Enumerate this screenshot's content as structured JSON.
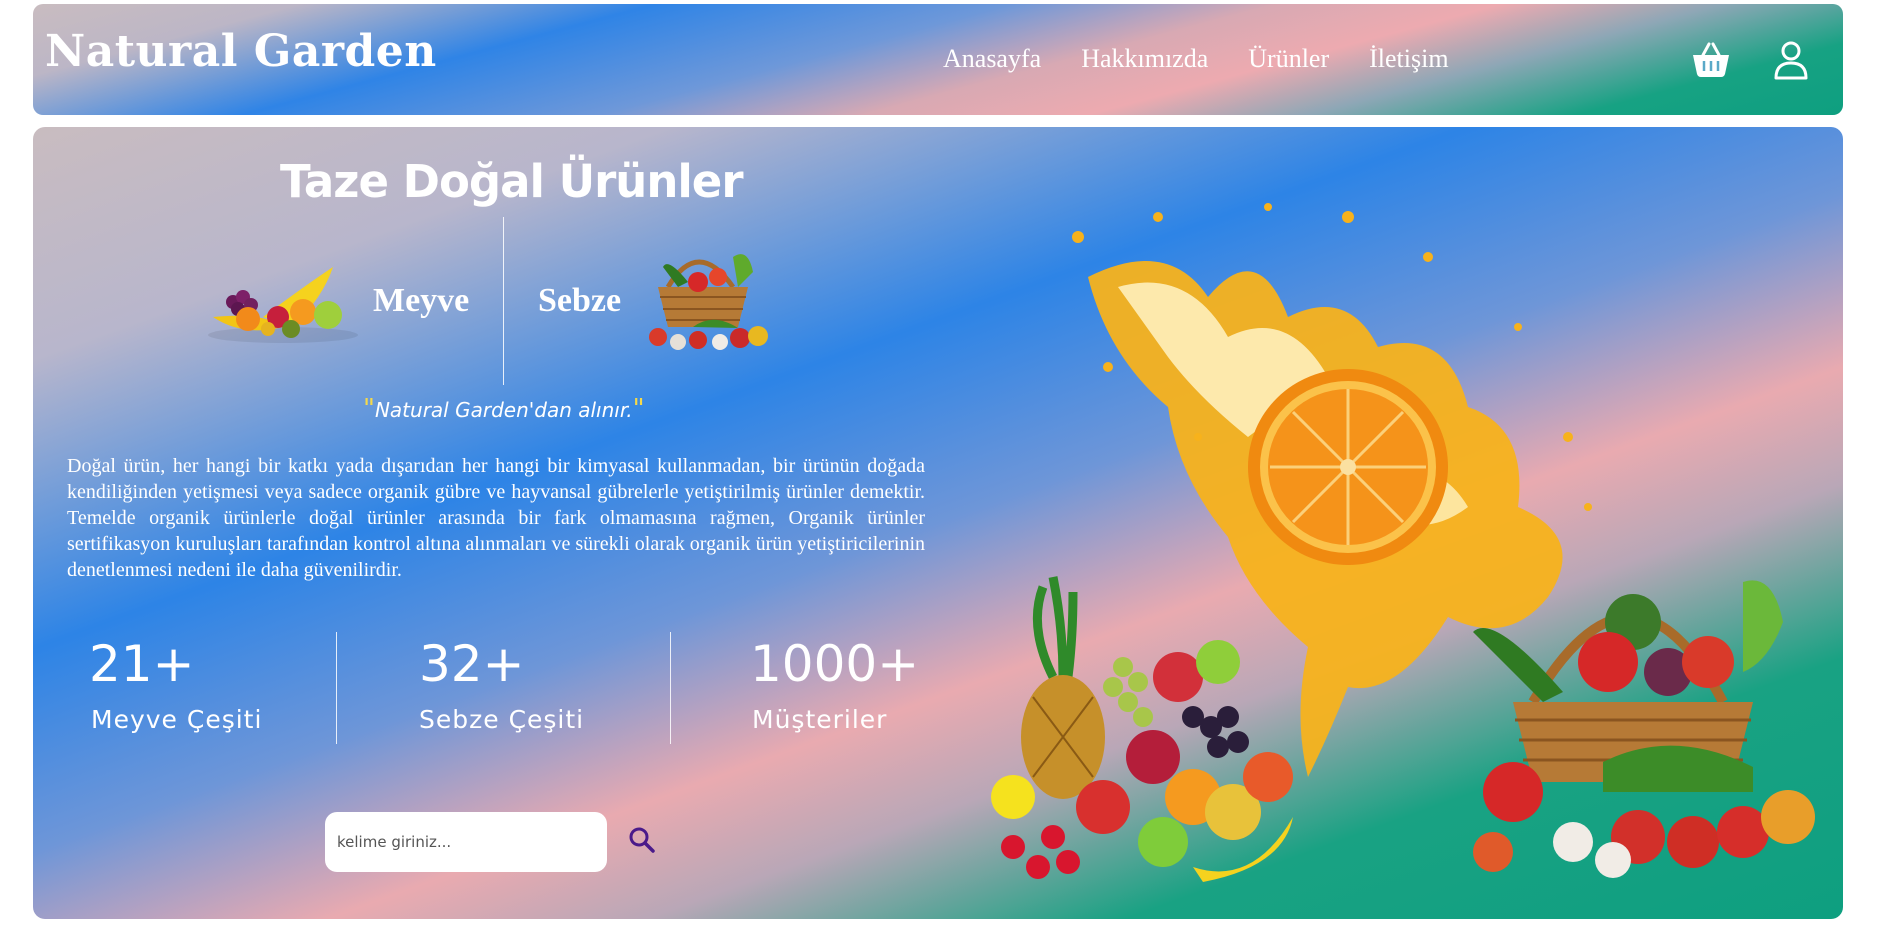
{
  "header": {
    "logo": "Natural Garden",
    "nav": [
      "Anasayfa",
      "Hakkımızda",
      "Ürünler",
      "İletişim"
    ],
    "icons": [
      "basket-icon",
      "user-icon"
    ]
  },
  "hero": {
    "title": "Taze Doğal Ürünler",
    "categories": {
      "fruit": "Meyve",
      "vegetable": "Sebze"
    },
    "tagline": "Natural Garden'dan alınır.",
    "description": "Doğal ürün, her hangi bir katkı yada dışarıdan her hangi bir kimyasal kullanmadan, bir ürünün doğada kendiliğinden yetişmesi veya sadece organik gübre ve hayvansal gübrelerle yetiştirilmiş ürünler demektir. Temelde organik ürünlerle doğal ürünler arasında bir fark olmamasına rağmen, Organik ürünler sertifikasyon kuruluşları tarafından kontrol altına alınmaları ve sürekli olarak organik ürün yetiştiricilerinin denetlenmesi nedeni ile daha güvenilirdir.",
    "stats": [
      {
        "value": "21+",
        "label": "Meyve Çeşiti"
      },
      {
        "value": "32+",
        "label": "Sebze Çeşiti"
      },
      {
        "value": "1000+",
        "label": "Müşteriler"
      }
    ],
    "search": {
      "placeholder": "kelime giriniz..."
    }
  },
  "colors": {
    "gradient": [
      "#c9bcc0",
      "#2d84e6",
      "#e9aab0",
      "#0e9f80"
    ],
    "search_icon": "#4a1a8a"
  }
}
